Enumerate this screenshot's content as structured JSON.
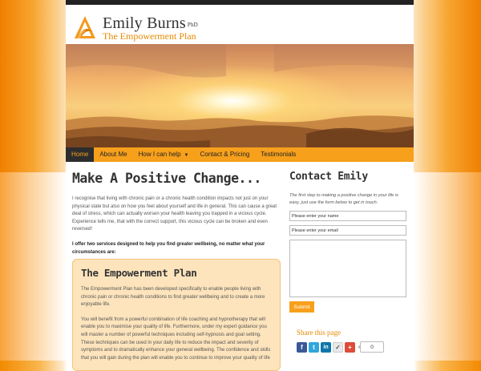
{
  "brand": {
    "name": "Emily Burns",
    "suffix": "PhD",
    "tagline": "The Empowerment Plan"
  },
  "nav": {
    "items": [
      {
        "label": "Home",
        "active": true
      },
      {
        "label": "About Me"
      },
      {
        "label": "How I can help"
      },
      {
        "label": "Contact & Pricing"
      },
      {
        "label": "Testimonials"
      }
    ]
  },
  "main": {
    "title": "Make A Positive Change...",
    "intro": "I recognise that living with chronic pain or a chronic health condition impacts not just on your physical state but also on how you feel about yourself and life in general. This can cause a great deal of stress, which can actually worsen your health leaving you trapped in a vicious cycle. Experience tells me, that with the correct support, this vicious cycle can be broken and even reversed!",
    "services": "I offer two services designed to help you find greater wellbeing, no matter what your circumstances are:",
    "plan": {
      "title": "The Empowerment Plan",
      "p1": "The Empowerment Plan has been developed specifically to enable people living with chronic pain or chronic health conditions to find greater wellbeing and to create a more enjoyable life.",
      "p2": "You will benefit from a powerful combination of life coaching and hypnotherapy that will enable you to maximise your quality of life. Furthermore, under my expert guidance you will master a number of powerful techniques including self-hypnosis and goal setting. These techniques can be used in your daily life to reduce the impact and severity of symptoms and to dramatically enhance your general wellbeing. The confidence and skills that you will gain during the plan will enable you to continue to improve your quality of life"
    }
  },
  "contact": {
    "title": "Contact Emily",
    "intro": "The first step to making a positive change in your life is easy, just use the form below to get in touch.",
    "name_value": "Please enter your name",
    "email_value": "Please enter your email",
    "submit_label": "Submit"
  },
  "share": {
    "title": "Share this page",
    "count": "0",
    "icons": [
      "facebook-icon",
      "twitter-icon",
      "linkedin-icon",
      "more-icon",
      "google-plus-icon"
    ]
  },
  "colors": {
    "accent": "#f7a01c",
    "dark": "#2d2d2d"
  }
}
